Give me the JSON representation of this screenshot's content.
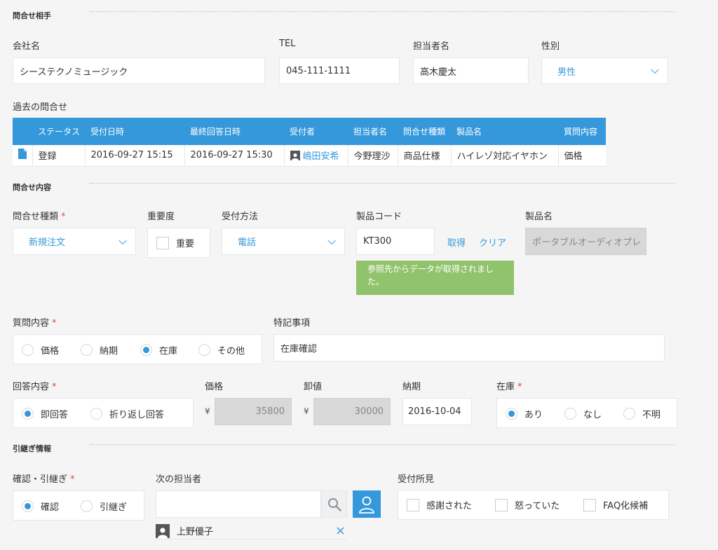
{
  "sections": {
    "contact": "問合せ相手",
    "inquiry": "問合せ内容",
    "handover": "引継ぎ情報"
  },
  "contact": {
    "company_label": "会社名",
    "company_value": "シーステクノミュージック",
    "tel_label": "TEL",
    "tel_value": "045-111-1111",
    "person_label": "担当者名",
    "person_value": "高木慶太",
    "gender_label": "性別",
    "gender_value": "男性"
  },
  "history": {
    "label": "過去の問合せ",
    "columns": [
      "ステータス",
      "受付日時",
      "最終回答日時",
      "受付者",
      "担当者名",
      "問合せ種類",
      "製品名",
      "質問内容"
    ],
    "rows": [
      {
        "status": "登録",
        "received": "2016-09-27 15:15",
        "last_answer": "2016-09-27 15:30",
        "receiver": "嶋田安希",
        "person": "今野理沙",
        "type": "商品仕様",
        "product": "ハイレゾ対応イヤホン",
        "question": "価格"
      }
    ]
  },
  "inquiry": {
    "type_label": "問合せ種類",
    "type_value": "新規注文",
    "importance_label": "重要度",
    "importance_option": "重要",
    "method_label": "受付方法",
    "method_value": "電話",
    "code_label": "製品コード",
    "code_value": "KT300",
    "fetch_link": "取得",
    "clear_link": "クリア",
    "tooltip": "参照先からデータが取得されました。",
    "product_label": "製品名",
    "product_value": "ポータブルオーディオプレ",
    "question_label": "質問内容",
    "question_options": [
      "価格",
      "納期",
      "在庫",
      "その他"
    ],
    "question_selected": "在庫",
    "notes_label": "特記事項",
    "notes_value": "在庫確認",
    "answer_label": "回答内容",
    "answer_options": [
      "即回答",
      "折り返し回答"
    ],
    "answer_selected": "即回答",
    "price_label": "価格",
    "price_value": "35800",
    "wholesale_label": "卸値",
    "wholesale_value": "30000",
    "yen": "¥",
    "delivery_label": "納期",
    "delivery_value": "2016-10-04",
    "stock_label": "在庫",
    "stock_options": [
      "あり",
      "なし",
      "不明"
    ],
    "stock_selected": "あり"
  },
  "handover": {
    "confirm_label": "確認・引継ぎ",
    "confirm_options": [
      "確認",
      "引継ぎ"
    ],
    "confirm_selected": "確認",
    "next_label": "次の担当者",
    "next_search_value": "",
    "selected_user": "上野優子",
    "impression_label": "受付所見",
    "impression_options": [
      "感謝された",
      "怒っていた",
      "FAQ化候補"
    ]
  },
  "required_mark": "*",
  "colors": {
    "accent": "#3498db",
    "tooltip": "#91c36c",
    "required": "#e74c3c"
  }
}
